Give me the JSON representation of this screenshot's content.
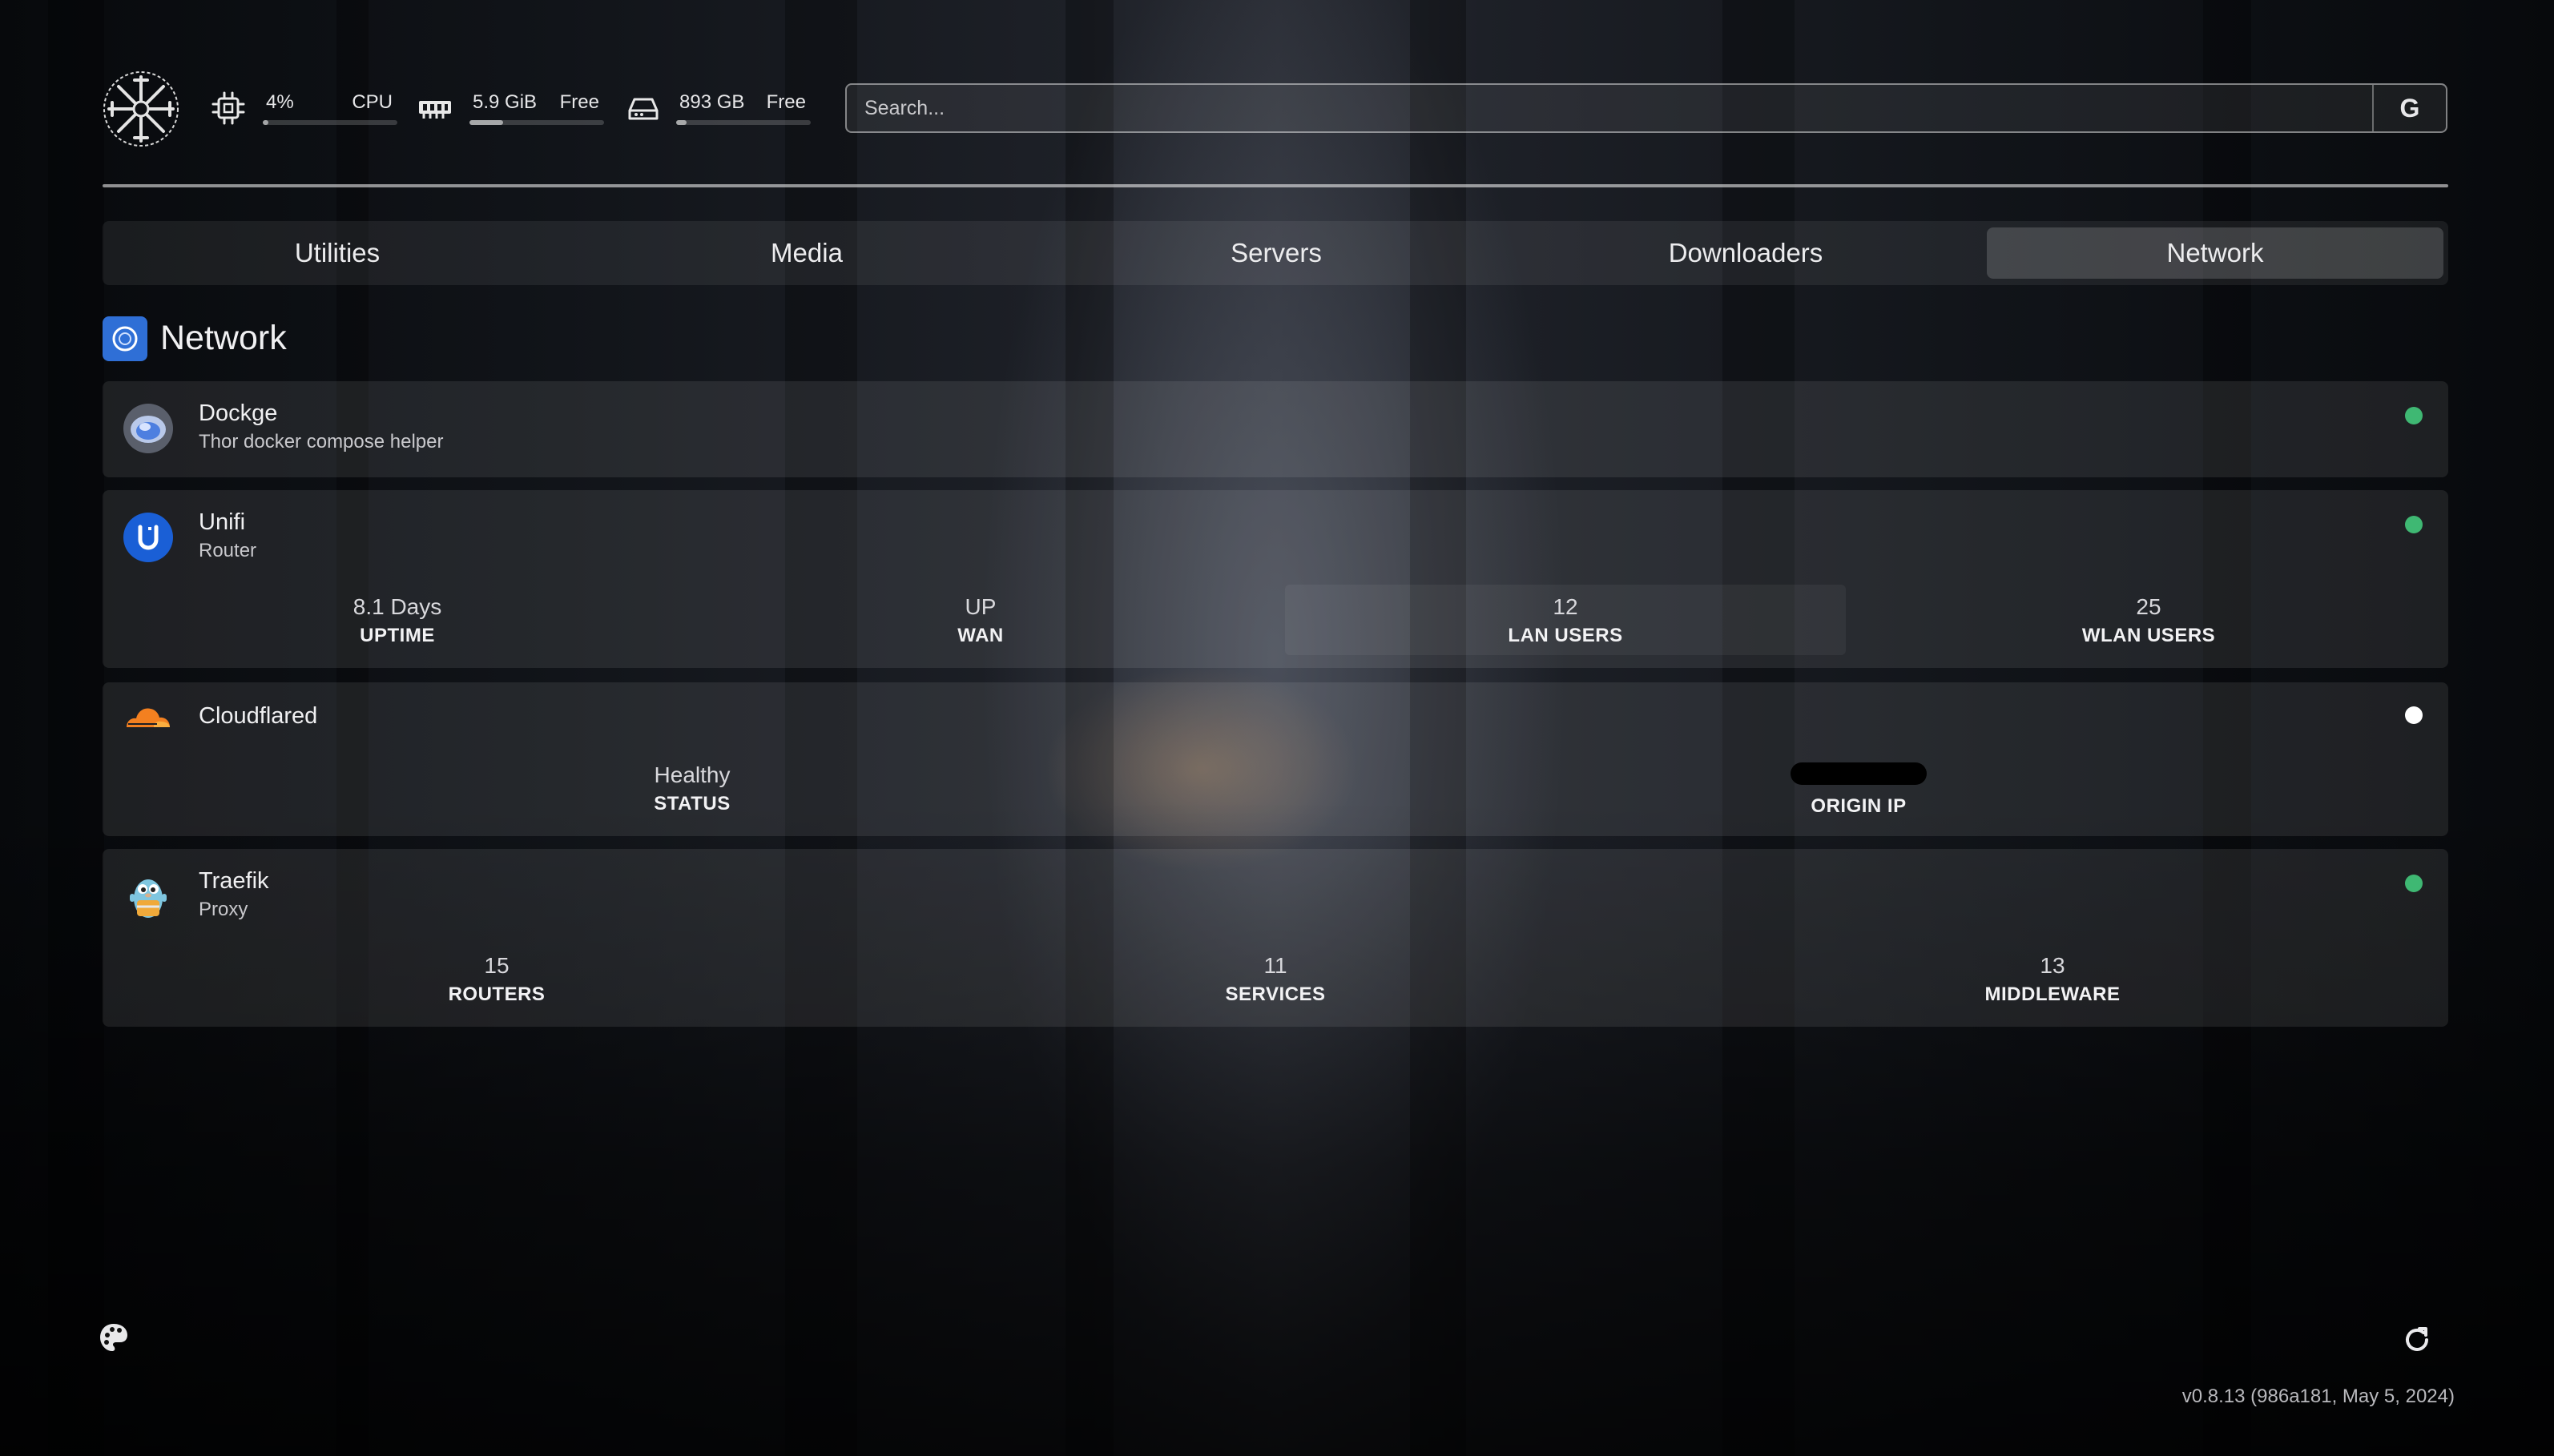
{
  "header": {
    "resources": [
      {
        "value": "4%",
        "label": "CPU",
        "usage": 0.04
      },
      {
        "value": "5.9 GiB",
        "label": "Free",
        "usage": 0.25
      },
      {
        "value": "893 GB",
        "label": "Free",
        "usage": 0.08
      }
    ],
    "search": {
      "placeholder": "Search...",
      "button_label": "G"
    }
  },
  "tabs": [
    {
      "label": "Utilities",
      "active": false
    },
    {
      "label": "Media",
      "active": false
    },
    {
      "label": "Servers",
      "active": false
    },
    {
      "label": "Downloaders",
      "active": false
    },
    {
      "label": "Network",
      "active": true
    }
  ],
  "group": {
    "title": "Network"
  },
  "services": [
    {
      "name": "Dockge",
      "description": "Thor docker compose helper",
      "status_color": "#3fb873"
    },
    {
      "name": "Unifi",
      "description": "Router",
      "status_color": "#3fb873",
      "stats": [
        {
          "value": "8.1 Days",
          "label": "UPTIME"
        },
        {
          "value": "UP",
          "label": "WAN"
        },
        {
          "value": "12",
          "label": "LAN USERS"
        },
        {
          "value": "25",
          "label": "WLAN USERS"
        }
      ]
    },
    {
      "name": "Cloudflared",
      "description": "",
      "status_color": "#ffffff",
      "stats": [
        {
          "value": "Healthy",
          "label": "STATUS"
        },
        {
          "value": "",
          "label": "ORIGIN IP"
        }
      ]
    },
    {
      "name": "Traefik",
      "description": "Proxy",
      "status_color": "#3fb873",
      "stats": [
        {
          "value": "15",
          "label": "ROUTERS"
        },
        {
          "value": "11",
          "label": "SERVICES"
        },
        {
          "value": "13",
          "label": "MIDDLEWARE"
        }
      ]
    }
  ],
  "footer": {
    "version": "v0.8.13 (986a181, May 5, 2024)"
  },
  "colors": {
    "status_ok": "#3fb873",
    "accent_blue": "#2f6fd6",
    "cloudflare_orange": "#f38020"
  }
}
